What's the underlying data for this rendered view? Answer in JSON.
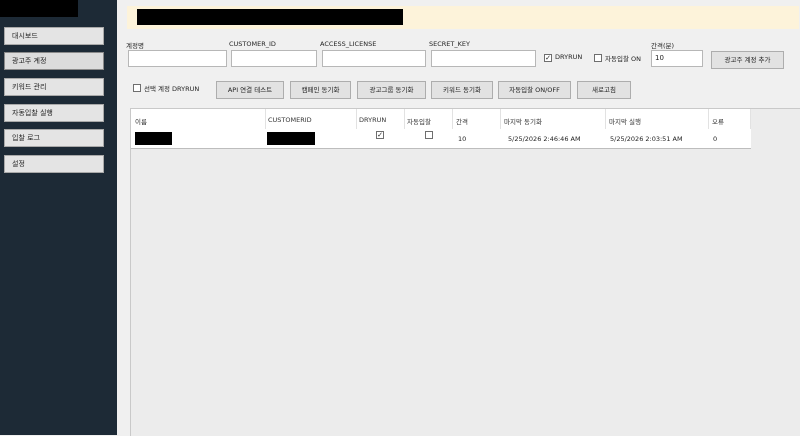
{
  "sidebar": {
    "items": [
      {
        "label": "대시보드"
      },
      {
        "label": "광고주 계정"
      },
      {
        "label": "키워드 관리"
      },
      {
        "label": "자동입찰 실행"
      },
      {
        "label": "입찰 로그"
      },
      {
        "label": "설정"
      }
    ]
  },
  "form": {
    "account_name_label": "계정명",
    "customer_id_label": "CUSTOMER_ID",
    "access_license_label": "ACCESS_LICENSE",
    "secret_key_label": "SECRET_KEY",
    "dryrun_label": "DRYRUN",
    "dryrun_checked": true,
    "auto_bid_label": "자동입찰 ON",
    "auto_bid_checked": false,
    "interval_label": "간격(분)",
    "interval_value": "10",
    "add_button": "광고주 계정 추가"
  },
  "toolbar": {
    "selected_dryrun_label": "선택 계정 DRYRUN",
    "selected_dryrun_checked": false,
    "buttons": [
      {
        "label": "API 연결 테스트"
      },
      {
        "label": "캠페인 동기화"
      },
      {
        "label": "광고그룹 동기화"
      },
      {
        "label": "키워드 동기화"
      },
      {
        "label": "자동입찰 ON/OFF"
      },
      {
        "label": "새로고침"
      }
    ]
  },
  "table": {
    "columns": [
      "이름",
      "CUSTOMERID",
      "DRYRUN",
      "자동입찰",
      "간격",
      "마지막 동기화",
      "마지막 실행",
      "오류"
    ],
    "rows": [
      {
        "dryrun": true,
        "auto_bid": false,
        "interval": "10",
        "last_sync": "5/25/2026 2:46:46 AM",
        "last_run": "5/25/2026 2:03:51 AM",
        "error": "0"
      }
    ]
  }
}
